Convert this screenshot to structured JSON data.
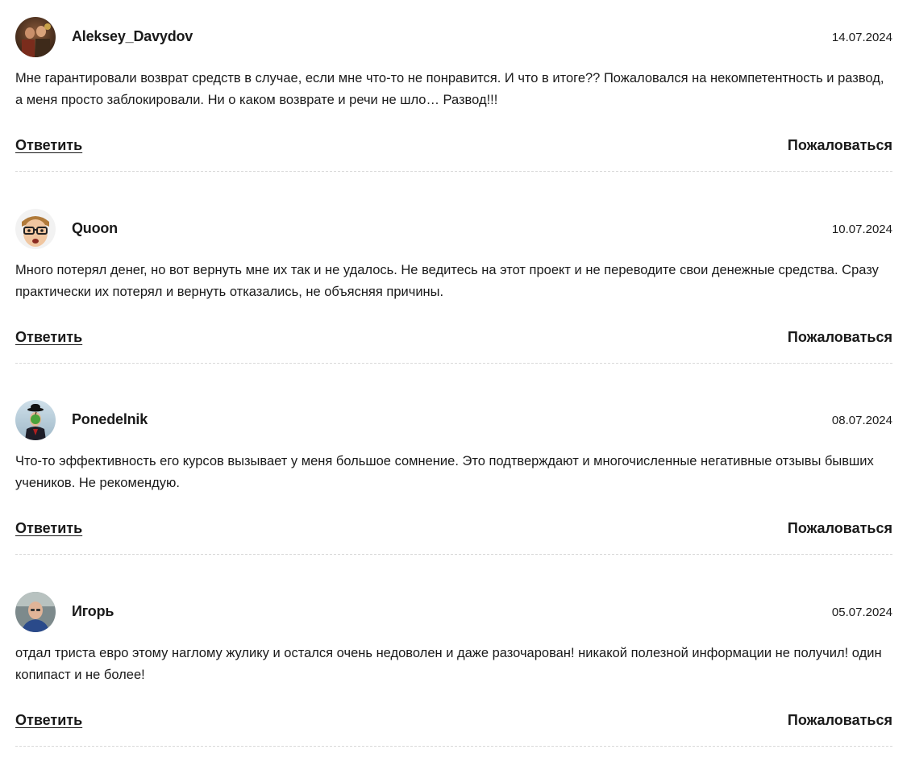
{
  "comments": [
    {
      "username": "Aleksey_Davydov",
      "date": "14.07.2024",
      "text": "Мне гарантировали возврат средств в случае, если мне что-то не понравится. И что в итоге?? Пожаловался на некомпетентность и развод, а меня просто заблокировали. Ни о каком возврате и речи не шло… Развод!!!",
      "reply_label": "Ответить",
      "report_label": "Пожаловаться",
      "avatar_icon": "avatar-painting-icon"
    },
    {
      "username": "Quoon",
      "date": "10.07.2024",
      "text": "Много потерял денег, но вот вернуть мне их так и не удалось. Не ведитесь на этот проект и не переводите свои денежные средства. Сразу практически их потерял и вернуть отказались, не объясняя причины.",
      "reply_label": "Ответить",
      "report_label": "Пожаловаться",
      "avatar_icon": "avatar-glasses-face-icon"
    },
    {
      "username": "Ponedelnik",
      "date": "08.07.2024",
      "text": "Что-то эффективность его курсов вызывает у меня большое сомнение. Это подтверждают и многочисленные негативные отзывы бывших учеников. Не рекомендую.",
      "reply_label": "Ответить",
      "report_label": "Пожаловаться",
      "avatar_icon": "avatar-bowler-hat-apple-icon"
    },
    {
      "username": "Игорь",
      "date": "05.07.2024",
      "text": "отдал триста евро этому наглому жулику и остался очень недоволен и даже разочарован! никакой полезной информации не получил! один копипаст и не более!",
      "reply_label": "Ответить",
      "report_label": "Пожаловаться",
      "avatar_icon": "avatar-photo-man-icon"
    }
  ]
}
